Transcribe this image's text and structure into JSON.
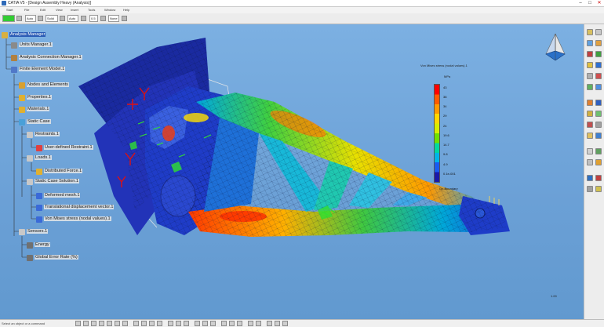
{
  "window": {
    "title": "CATIA V5 - [Design Assembly Heavy (Analysis)]",
    "controls": [
      "–",
      "□",
      "✕"
    ]
  },
  "menu": [
    "Start",
    "File",
    "Edit",
    "View",
    "Insert",
    "Tools",
    "Window",
    "Help"
  ],
  "toolbar": {
    "field1": "",
    "field2": "Auto",
    "field3": "Solid",
    "field4": "Auto",
    "field5": "0.5",
    "field6": "None"
  },
  "tree": {
    "root": "Analysis Manager",
    "units": "Units Manager.1",
    "connections": "Analysis Connection Manager.1",
    "fem": "Finite Element Model.1",
    "nodes": "Nodes and Elements",
    "properties": "Properties.1",
    "materials": "Materials.1",
    "static_case": "Static Case",
    "restraints": "Restraints.1",
    "user_restraint": "User-defined Restraint.1",
    "loads": "Loads.1",
    "force": "Distributed Force.1",
    "solution": "Static Case Solution.1",
    "mesh": "Deformed mesh.1",
    "displacement": "Translational displacement vector.1",
    "von_mises": "Von Mises stress (nodal values).1",
    "sensors": "Sensors.1",
    "energy": "Energy",
    "error_rate": "Global Error Rate (%)"
  },
  "legend": {
    "title": "Von Mises stress (nodal values).1",
    "unit": "MPa",
    "values": [
      "43",
      "38",
      "34",
      "29",
      "24",
      "19.6",
      "14.7",
      "9.8",
      "4.9",
      "0.1e-001"
    ],
    "colors": [
      "#ff0000",
      "#ff5a00",
      "#ff9a00",
      "#ffd800",
      "#d6ee00",
      "#6fe000",
      "#00d8a0",
      "#00b4e8",
      "#1a5cf0",
      "#1a1aa8"
    ],
    "note": "On Boundary"
  },
  "viewport": {
    "zoom_label": "1.00"
  },
  "status": {
    "prompt": "Select an object or a command"
  }
}
